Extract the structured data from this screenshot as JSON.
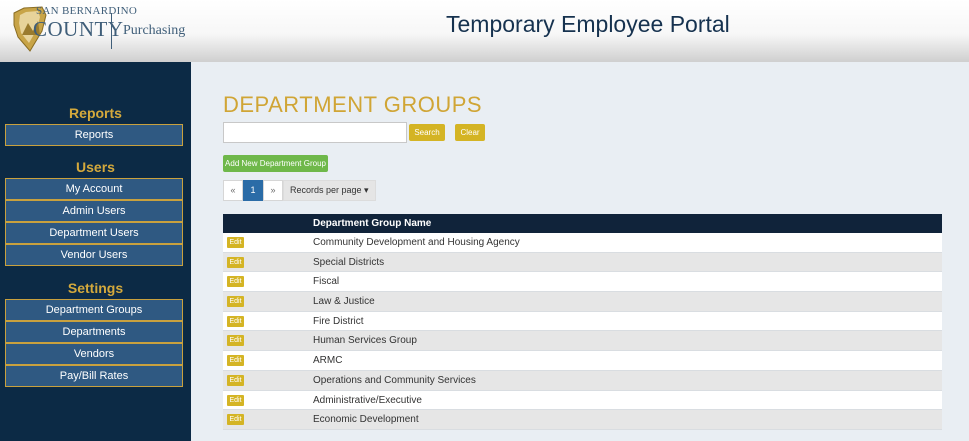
{
  "header": {
    "logo_line1": "SAN BERNARDINO",
    "logo_line2": "COUNTY",
    "department": "Purchasing",
    "title": "Temporary Employee Portal"
  },
  "sidebar": {
    "sections": [
      {
        "heading": "Reports",
        "items": [
          "Reports"
        ]
      },
      {
        "heading": "Users",
        "items": [
          "My Account",
          "Admin Users",
          "Department Users",
          "Vendor Users"
        ]
      },
      {
        "heading": "Settings",
        "items": [
          "Department Groups",
          "Departments",
          "Vendors",
          "Pay/Bill Rates"
        ]
      }
    ]
  },
  "main": {
    "page_title": "DEPARTMENT GROUPS",
    "search": {
      "value": "",
      "placeholder": ""
    },
    "search_button": "Search",
    "clear_button": "Clear",
    "add_button": "Add New Department Group",
    "pager": {
      "prev": "«",
      "current": "1",
      "next": "»",
      "records_per_page": "Records per page ▾"
    },
    "table": {
      "column": "Department Group Name",
      "edit_label": "Edit",
      "rows": [
        "Community Development and Housing Agency",
        "Special Districts",
        "Fiscal",
        "Law & Justice",
        "Fire District",
        "Human Services Group",
        "ARMC",
        "Operations and Community Services",
        "Administrative/Executive",
        "Economic Development"
      ]
    }
  },
  "colors": {
    "sidebar_bg": "#0c2a45",
    "sidebar_button": "#2f5982",
    "accent_gold": "#d4b424",
    "title_gold": "#d0a535",
    "add_green": "#6fb84a",
    "table_header": "#10233a",
    "pager_active": "#2b6ca7"
  }
}
